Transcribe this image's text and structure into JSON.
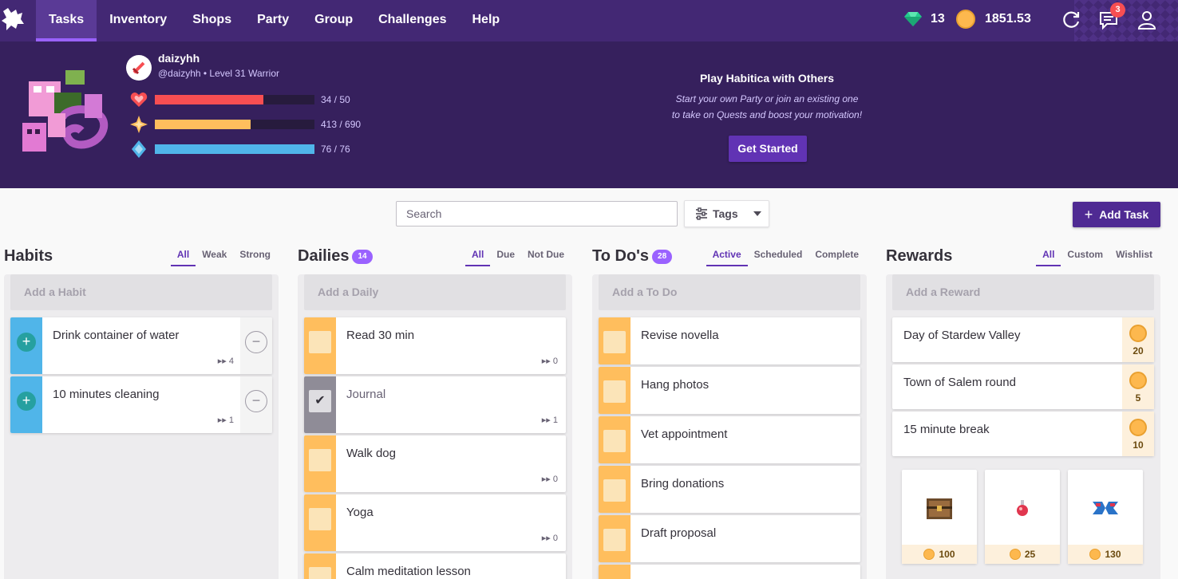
{
  "nav": {
    "items": [
      {
        "label": "Tasks",
        "active": true
      },
      {
        "label": "Inventory"
      },
      {
        "label": "Shops"
      },
      {
        "label": "Party"
      },
      {
        "label": "Group"
      },
      {
        "label": "Challenges"
      },
      {
        "label": "Help"
      }
    ],
    "gems": "13",
    "gold": "1851.53",
    "notification_count": "3",
    "icons": [
      "sync-icon",
      "chat-icon",
      "user-icon"
    ]
  },
  "profile": {
    "username": "daizyhh",
    "subline": "@daizyhh • Level 31 Warrior",
    "class_icon": "sword-icon",
    "stats": [
      {
        "name": "health",
        "icon": "heart-icon",
        "text": "34 / 50",
        "fraction": 0.68,
        "color": "#f74e52"
      },
      {
        "name": "experience",
        "icon": "star-icon",
        "text": "413 / 690",
        "fraction": 0.5986,
        "color": "#ffbe5d"
      },
      {
        "name": "mana",
        "icon": "mana-icon",
        "text": "76 / 76",
        "fraction": 1.0,
        "color": "#50b5e9"
      }
    ]
  },
  "party_cta": {
    "title": "Play Habitica with Others",
    "line1": "Start your own Party or join an existing one",
    "line2": "to take on Quests and boost your motivation!",
    "button": "Get Started"
  },
  "toolbar": {
    "search_placeholder": "Search",
    "tags_label": "Tags",
    "add_task_label": "Add Task"
  },
  "habits": {
    "title": "Habits",
    "filters": [
      "All",
      "Weak",
      "Strong"
    ],
    "add_placeholder": "Add a Habit",
    "items": [
      {
        "text": "Drink container of water",
        "streak": "4"
      },
      {
        "text": "10 minutes cleaning",
        "streak": "1"
      }
    ]
  },
  "dailies": {
    "title": "Dailies",
    "count": "14",
    "filters": [
      "All",
      "Due",
      "Not Due"
    ],
    "add_placeholder": "Add a Daily",
    "items": [
      {
        "text": "Read 30 min",
        "streak": "0",
        "done": false
      },
      {
        "text": "Journal",
        "streak": "1",
        "done": true
      },
      {
        "text": "Walk dog",
        "streak": "0",
        "done": false
      },
      {
        "text": "Yoga",
        "streak": "0",
        "done": false
      },
      {
        "text": "Calm meditation lesson",
        "done": false
      }
    ]
  },
  "todos": {
    "title": "To Do's",
    "count": "28",
    "filters": [
      "Active",
      "Scheduled",
      "Complete"
    ],
    "add_placeholder": "Add a To Do",
    "items": [
      {
        "text": "Revise novella"
      },
      {
        "text": "Hang photos"
      },
      {
        "text": "Vet appointment"
      },
      {
        "text": "Bring donations"
      },
      {
        "text": "Draft proposal"
      }
    ]
  },
  "rewards": {
    "title": "Rewards",
    "filters": [
      "All",
      "Custom",
      "Wishlist"
    ],
    "add_placeholder": "Add a Reward",
    "items": [
      {
        "text": "Day of Stardew Valley",
        "price": "20"
      },
      {
        "text": "Town of Salem round",
        "price": "5"
      },
      {
        "text": "15 minute break",
        "price": "10"
      }
    ],
    "shop_items": [
      {
        "icon": "treasure-chest-icon",
        "price": "100"
      },
      {
        "icon": "health-potion-icon",
        "price": "25"
      },
      {
        "icon": "armoire-icon",
        "price": "130"
      }
    ]
  },
  "colors": {
    "nav_bg": "#432874",
    "header_bg": "#36205d",
    "habit_side": "#50b5e9",
    "daily_side": "#ffbe5d",
    "done_side": "#8f8c97",
    "accent": "#6133b4"
  }
}
